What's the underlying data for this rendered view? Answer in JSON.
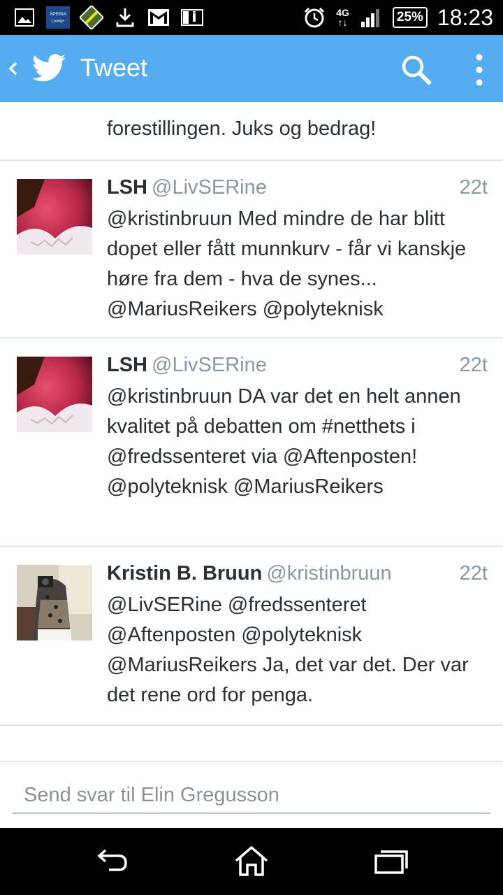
{
  "status_bar": {
    "time": "18:23",
    "battery": "25%",
    "network": "4G",
    "icons": [
      "image-icon",
      "xperia-lounge-icon",
      "game-icon",
      "download-icon",
      "gmail-icon",
      "info-icon",
      "alarm-icon",
      "signal-icon",
      "battery-icon"
    ]
  },
  "appbar": {
    "title": "Tweet",
    "color": "#55acee"
  },
  "timeline": {
    "partial_top": "forestillingen. Juks og bedrag!",
    "tweets": [
      {
        "name": "LSH",
        "handle": "@LivSERine",
        "time": "22t",
        "text": "@kristinbruun Med mindre de har blitt dopet eller fått munnkurv - får vi kanskje høre fra dem - hva de synes... @MariusReikers @polyteknisk"
      },
      {
        "name": "LSH",
        "handle": "@LivSERine",
        "time": "22t",
        "text": "@kristinbruun DA var det en helt annen kvalitet på debatten om #netthets i @fredssenteret via @Aftenposten! @polyteknisk @MariusReikers"
      },
      {
        "name": "Kristin B. Bruun",
        "handle": "@kristinbruun",
        "time": "22t",
        "text": "@LivSERine @fredssenteret @Aftenposten @polyteknisk @MariusReikers Ja,  det var det. Der var det rene ord for penga."
      }
    ]
  },
  "reply": {
    "placeholder": "Send svar til Elin Gregusson"
  }
}
